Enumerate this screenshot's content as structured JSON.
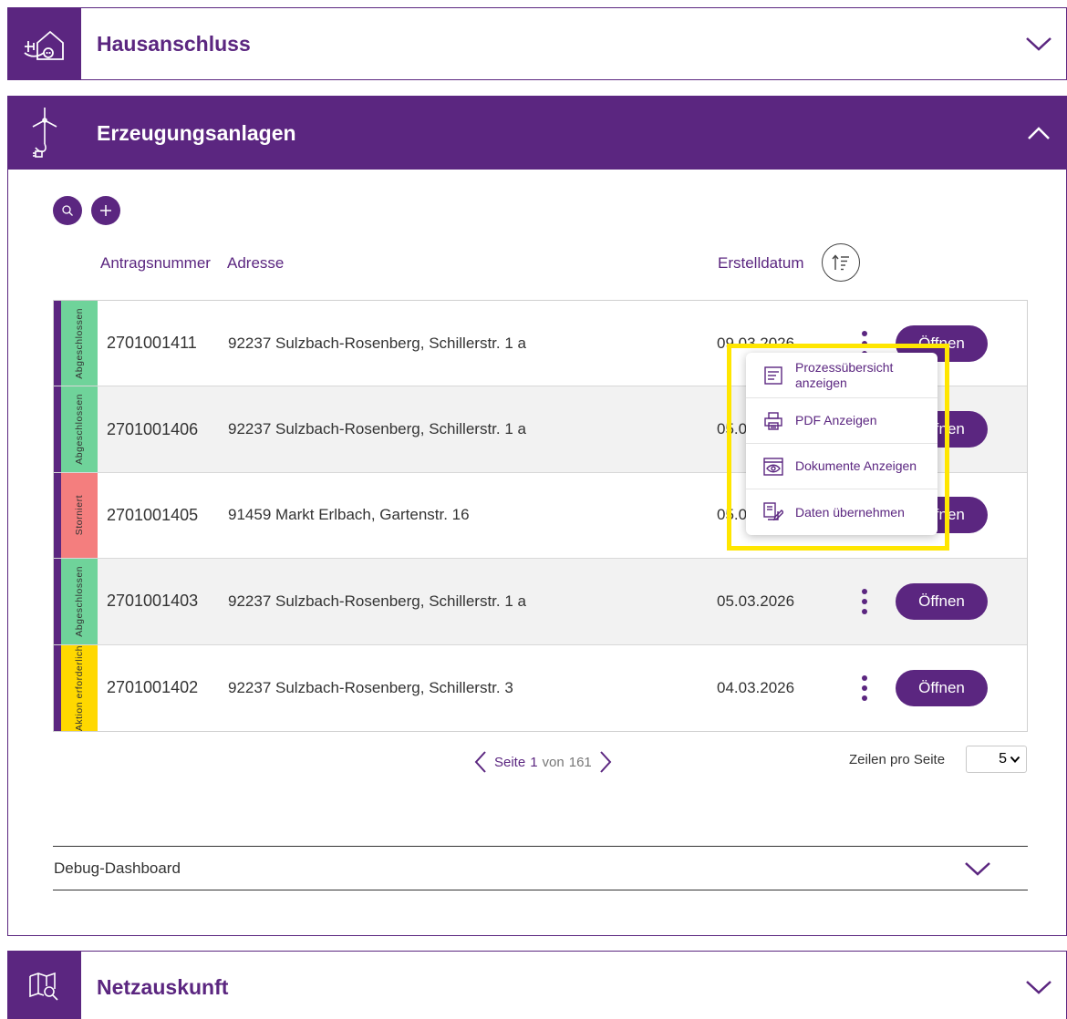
{
  "sections": {
    "hausanschluss": {
      "title": "Hausanschluss"
    },
    "erzeugung": {
      "title": "Erzeugungsanlagen"
    },
    "netzauskunft": {
      "title": "Netzauskunft"
    }
  },
  "table": {
    "headers": {
      "number": "Antragsnummer",
      "address": "Adresse",
      "date": "Erstelldatum"
    },
    "rows": [
      {
        "status": "Abgeschlossen",
        "status_color": "#6fd39a",
        "number": "2701001411",
        "address": "92237 Sulzbach-Rosenberg, Schillerstr. 1 a",
        "date": "09.03.2026",
        "action": "Öffnen"
      },
      {
        "status": "Abgeschlossen",
        "status_color": "#6fd39a",
        "number": "2701001406",
        "address": "92237 Sulzbach-Rosenberg, Schillerstr. 1 a",
        "date": "05.03.2026",
        "action": "Öffnen"
      },
      {
        "status": "Storniert",
        "status_color": "#f47e7e",
        "number": "2701001405",
        "address": "91459 Markt Erlbach, Gartenstr. 16",
        "date": "05.03.2026",
        "action": "Öffnen"
      },
      {
        "status": "Abgeschlossen",
        "status_color": "#6fd39a",
        "number": "2701001403",
        "address": "92237 Sulzbach-Rosenberg, Schillerstr. 1 a",
        "date": "05.03.2026",
        "action": "Öffnen"
      },
      {
        "status": "Aktion erforderlich",
        "status_color": "#ffd800",
        "number": "2701001402",
        "address": "92237 Sulzbach-Rosenberg, Schillerstr. 3",
        "date": "04.03.2026",
        "action": "Öffnen"
      }
    ]
  },
  "pagination": {
    "page_label": "Seite",
    "current": "1",
    "of_label": "von",
    "total": "161",
    "rows_label": "Zeilen pro Seite",
    "rows_value": "5"
  },
  "debug": {
    "label": "Debug-Dashboard"
  },
  "menu": {
    "items": [
      {
        "label": "Prozessübersicht anzeigen",
        "icon": "document-list-icon"
      },
      {
        "label": "PDF Anzeigen",
        "icon": "printer-icon"
      },
      {
        "label": "Dokumente Anzeigen",
        "icon": "eye-icon"
      },
      {
        "label": "Daten übernehmen",
        "icon": "edit-copy-icon"
      }
    ]
  },
  "colors": {
    "brand": "#5b2680",
    "highlight": "#ffe600"
  }
}
